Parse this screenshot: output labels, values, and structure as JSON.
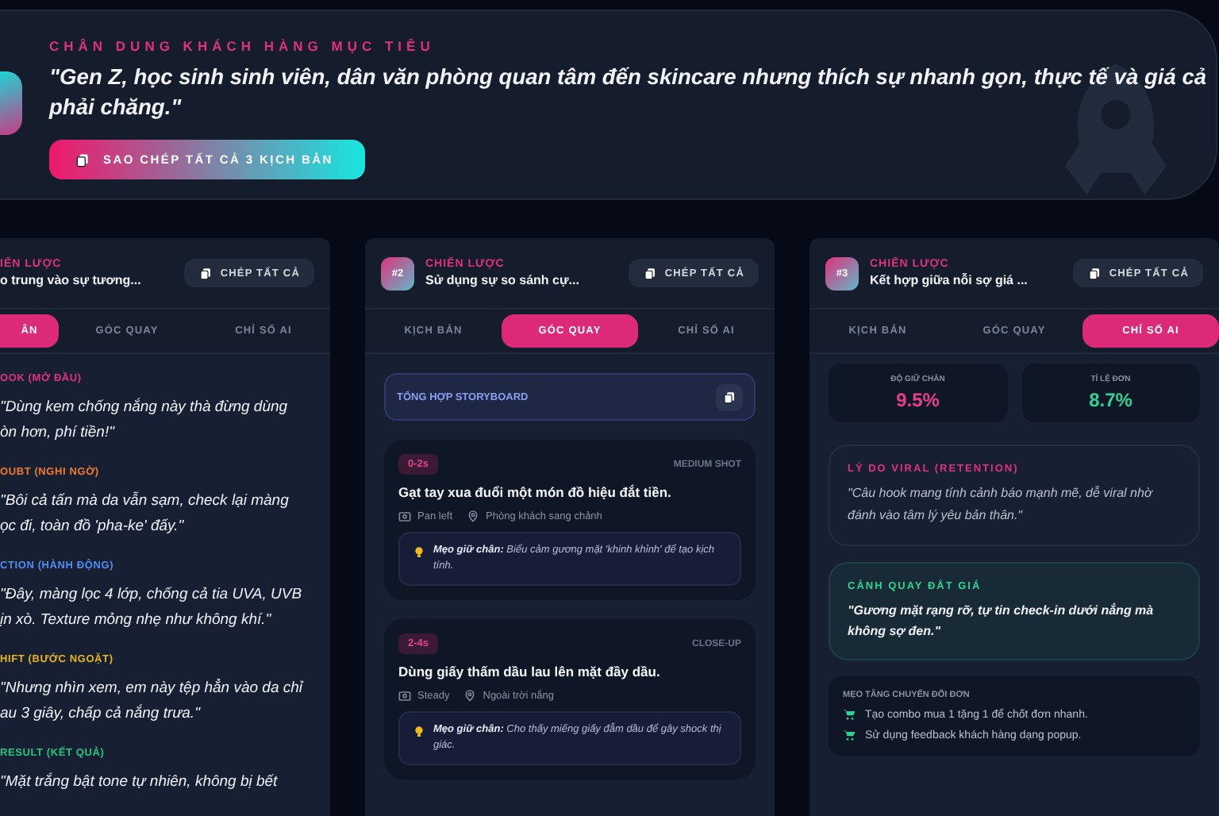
{
  "header": {
    "label": "CHÂN DUNG KHÁCH HÀNG MỤC TIÊU",
    "quote": "\"Gen Z, học sinh sinh viên, dân văn phòng quan tâm đến skincare nhưng thích sự nhanh gọn, thực tế và giá cả phải chăng.\"",
    "button": "SAO CHÉP TẤT CẢ 3 KỊCH BẢN"
  },
  "columns": [
    {
      "kind": "script",
      "label": "IẾN LƯỢC",
      "title": "o trung vào sự tương...",
      "copy_button": "CHÉP TẤT CẢ",
      "tabs": [
        {
          "label": "ÂN",
          "selected": true
        },
        {
          "label": "GÓC QUAY",
          "selected": false
        },
        {
          "label": "CHỈ SỐ AI",
          "selected": false
        }
      ],
      "sections": [
        {
          "label": "OOK (MỞ ĐẦU)",
          "color": "#e0317c",
          "lines": [
            "\"Dùng kem chống nắng này thà đừng dùng",
            "òn hơn, phí tiền!\""
          ]
        },
        {
          "label": "OUBT (NGHI NGỜ)",
          "color": "#f07a2a",
          "lines": [
            "\"Bôi cả tấn mà da vẫn sạm, check lại màng",
            "ọc đi, toàn đồ 'pha-ke' đấy.\""
          ]
        },
        {
          "label": "CTION (HÀNH ĐỘNG)",
          "color": "#4f8df0",
          "lines": [
            "\"Đây, màng lọc 4 lớp, chống cả tia UVA, UVB",
            "ịn xò. Texture mỏng nhẹ như không khí.\""
          ]
        },
        {
          "label": "HIFT (BƯỚC NGOẶT)",
          "color": "#e6b414",
          "lines": [
            "\"Nhưng nhìn xem, em này tệp hẳn vào da chỉ",
            "au 3 giây, chấp cả nắng trưa.\""
          ]
        },
        {
          "label": "RESULT (KẾT QUẢ)",
          "color": "#22c57e",
          "lines": [
            "\"Mặt trắng bật tone tự nhiên, không bị bết"
          ]
        }
      ]
    },
    {
      "kind": "shots",
      "badge": "#2",
      "label": "CHIẾN LƯỢC",
      "title": "Sử dụng sự so sánh cự...",
      "copy_button": "CHÉP TẤT CẢ",
      "tabs": [
        {
          "label": "KỊCH BẢN",
          "selected": false
        },
        {
          "label": "GÓC QUAY",
          "selected": true
        },
        {
          "label": "CHỈ SỐ AI",
          "selected": false
        }
      ],
      "storyboard": "TỔNG HỢP STORYBOARD",
      "shots": [
        {
          "time": "0-2s",
          "shot": "MEDIUM SHOT",
          "action": "Gạt tay xua đuổi một món đồ hiệu đắt tiền.",
          "camera": "Pan left",
          "location": "Phòng khách sang chảnh",
          "tip": "**Mẹo giữ chân:** Biểu cảm gương mặt 'khinh khỉnh' để tạo kịch tính."
        },
        {
          "time": "2-4s",
          "shot": "CLOSE-UP",
          "action": "Dùng giấy thấm dầu lau lên mặt đầy dầu.",
          "camera": "Steady",
          "location": "Ngoài trời nắng",
          "tip": "**Mẹo giữ chân:** Cho thấy miếng giấy đẫm dầu để gây shock thị giác."
        }
      ]
    },
    {
      "kind": "metrics",
      "badge": "#3",
      "label": "CHIẾN LƯỢC",
      "title": "Kết hợp giữa nỗi sợ giá ...",
      "copy_button": "CHÉP TẤT CẢ",
      "tabs": [
        {
          "label": "KỊCH BẢN",
          "selected": false
        },
        {
          "label": "GÓC QUAY",
          "selected": false
        },
        {
          "label": "CHỈ SỐ AI",
          "selected": true
        }
      ],
      "metrics": [
        {
          "label": "ĐỘ GIỮ CHÂN",
          "value": "9.5%",
          "color": "#ec3d86"
        },
        {
          "label": "TỈ LỆ ĐƠN",
          "value": "8.7%",
          "color": "#2fd391"
        }
      ],
      "viral": {
        "label": "LÝ DO VIRAL (RETENTION)",
        "text": "\"Câu hook mang tính cảnh báo mạnh mẽ, dễ viral nhờ đánh vào tâm lý yêu bản thân.\""
      },
      "best_shot": {
        "label": "CẢNH QUAY ĐẮT GIÁ",
        "text": "\"Gương mặt rạng rỡ, tự tin check-in dưới nắng mà không sợ đen.\""
      },
      "tips": {
        "label": "MẸO TĂNG CHUYỂN ĐỔI ĐƠN",
        "items": [
          "Tạo combo mua 1 tặng 1 để chốt đơn nhanh.",
          "Sử dụng feedback khách hàng dạng popup."
        ]
      }
    }
  ]
}
